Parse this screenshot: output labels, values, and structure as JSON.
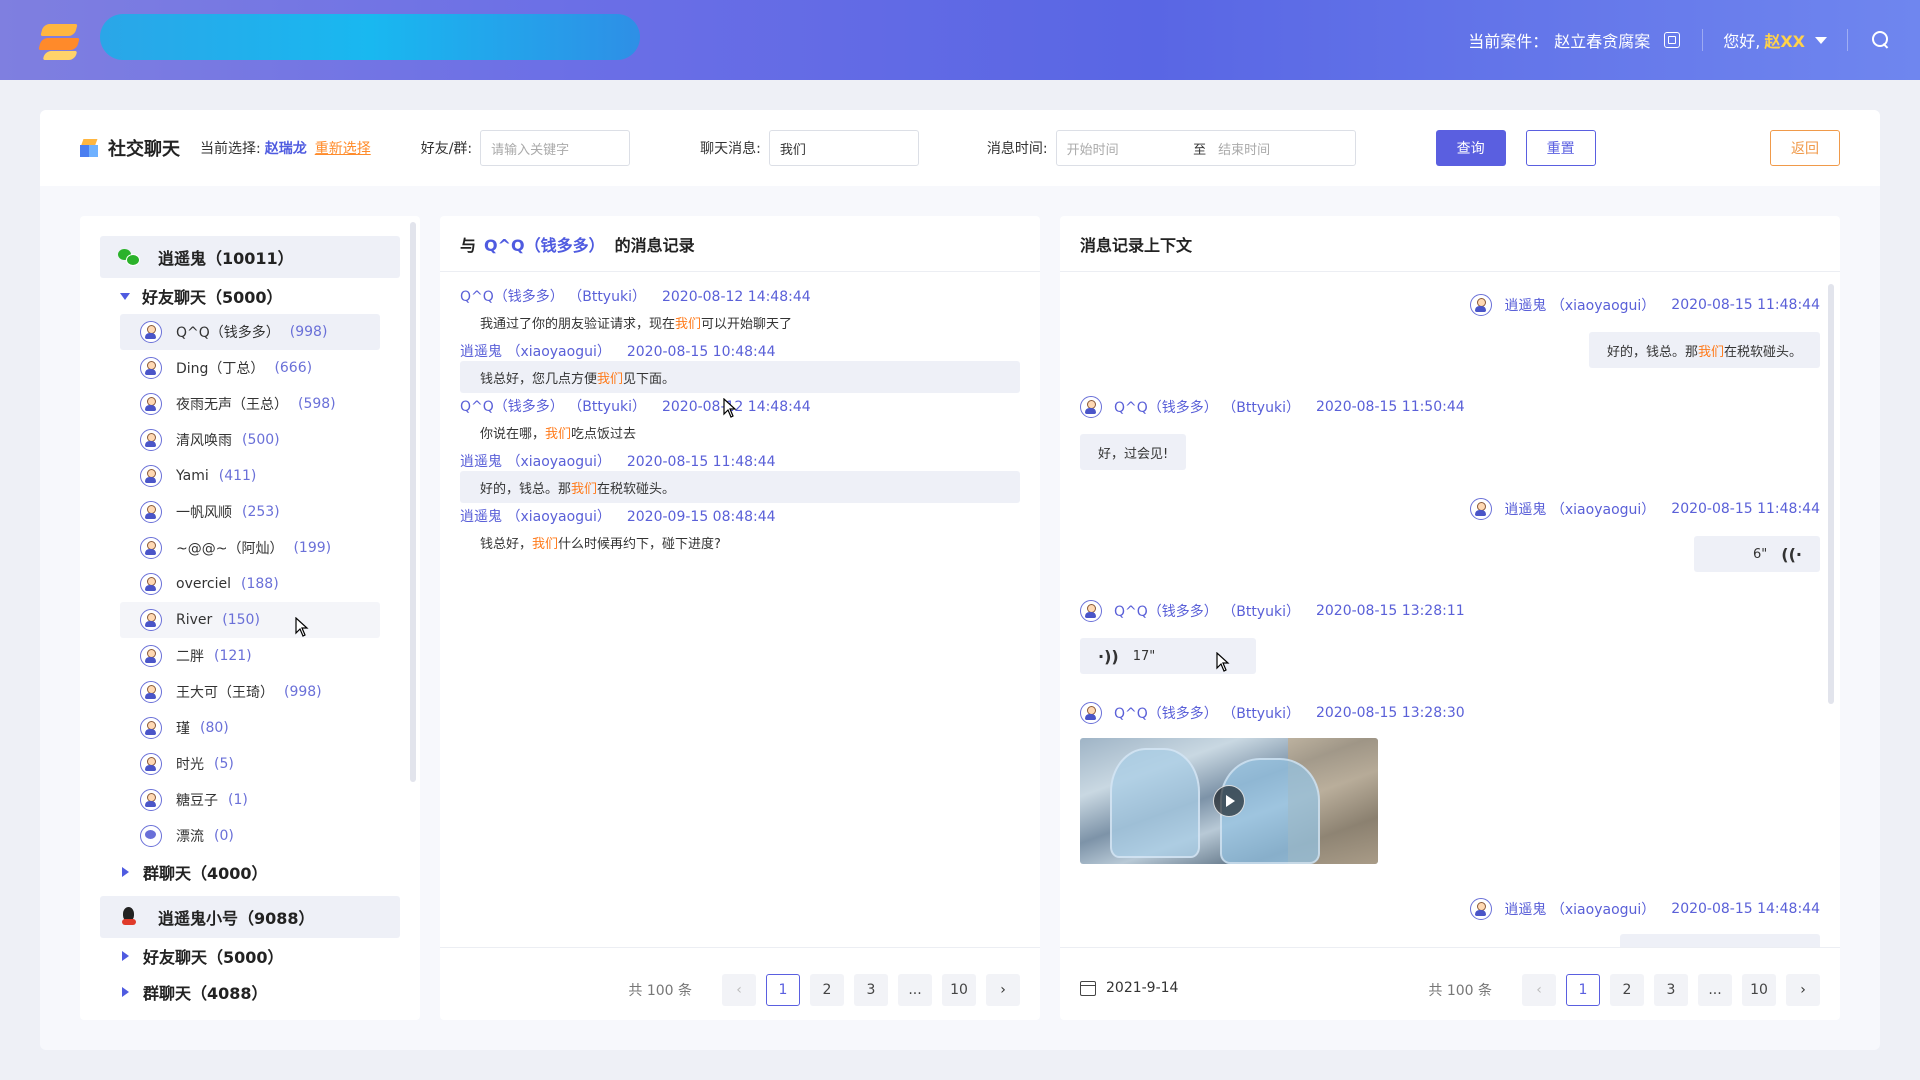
{
  "header": {
    "case_label": "当前案件：",
    "case_value": "赵立春贪腐案",
    "greeting": "您好,",
    "user_name": "赵XX"
  },
  "filter": {
    "title": "社交聊天",
    "current_label": "当前选择:",
    "current_name": "赵瑞龙",
    "reselect": "重新选择",
    "friend_label": "好友/群:",
    "friend_placeholder": "请输入关键字",
    "msg_label": "聊天消息:",
    "msg_value": "我们",
    "time_label": "消息时间:",
    "start_placeholder": "开始时间",
    "range_sep": "至",
    "end_placeholder": "结束时间",
    "query_btn": "查询",
    "reset_btn": "重置",
    "back_btn": "返回"
  },
  "sidebar": {
    "account1": "逍遥鬼（10011）",
    "friends_group": "好友聊天（5000）",
    "friends": [
      {
        "name": "Q^Q（钱多多）",
        "count": "(998)"
      },
      {
        "name": "Ding（丁总）",
        "count": "(666)"
      },
      {
        "name": "夜雨无声（王总）",
        "count": "(598)"
      },
      {
        "name": "清风唤雨",
        "count": "(500)"
      },
      {
        "name": "Yami",
        "count": "(411)"
      },
      {
        "name": "一帆风顺",
        "count": "(253)"
      },
      {
        "name": "~@@~（阿灿）",
        "count": "(199)"
      },
      {
        "name": "overciel",
        "count": "(188)"
      },
      {
        "name": "River",
        "count": "(150)"
      },
      {
        "name": "二胖",
        "count": "(121)"
      },
      {
        "name": "王大可（王琦）",
        "count": "(998)"
      },
      {
        "name": "瑾",
        "count": "(80)"
      },
      {
        "name": "时光",
        "count": "(5)"
      },
      {
        "name": "糖豆子",
        "count": "(1)"
      },
      {
        "name": "漂流",
        "count": "(0)"
      }
    ],
    "group_chat1": "群聊天（4000）",
    "account2": "逍遥鬼小号（9088）",
    "friends_group2": "好友聊天（5000）",
    "group_chat2": "群聊天（4088）"
  },
  "messages": {
    "head_prefix": "与",
    "head_contact": "Q^Q（钱多多）",
    "head_suffix": "的消息记录",
    "items": [
      {
        "sender": "Q^Q（钱多多） （Bttyuki）",
        "time": "2020-08-12 14:48:44",
        "pre": "我通过了你的朋友验证请求，现在",
        "kw": "我们",
        "post": "可以开始聊天了"
      },
      {
        "sender": "逍遥鬼 （xiaoyaogui）",
        "time": "2020-08-15 10:48:44",
        "pre": "钱总好，您几点方便",
        "kw": "我们",
        "post": "见下面。"
      },
      {
        "sender": "Q^Q（钱多多） （Bttyuki）",
        "time": "2020-08-12 14:48:44",
        "pre": "你说在哪，",
        "kw": "我们",
        "post": "吃点饭过去"
      },
      {
        "sender": "逍遥鬼 （xiaoyaogui）",
        "time": "2020-08-15 11:48:44",
        "pre": "好的，钱总。那",
        "kw": "我们",
        "post": "在税软碰头。"
      },
      {
        "sender": "逍遥鬼 （xiaoyaogui）",
        "time": "2020-09-15 08:48:44",
        "pre": "钱总好，",
        "kw": "我们",
        "post": "什么时候再约下，碰下进度?"
      }
    ],
    "pager": {
      "total": "共 100 条",
      "pages": [
        "1",
        "2",
        "3",
        "...",
        "10"
      ]
    }
  },
  "context": {
    "title": "消息记录上下文",
    "items": [
      {
        "sender": "逍遥鬼 （xiaoyaogui）",
        "time": "2020-08-15 11:48:44",
        "pre": "好的，钱总。那",
        "kw": "我们",
        "post": "在税软碰头。"
      },
      {
        "sender": "Q^Q（钱多多） （Bttyuki）",
        "time": "2020-08-15 11:50:44",
        "text": "好，过会见!"
      },
      {
        "sender": "逍遥鬼 （xiaoyaogui）",
        "time": "2020-08-15 11:48:44",
        "voice": "6\""
      },
      {
        "sender": "Q^Q（钱多多） （Bttyuki）",
        "time": "2020-08-15 13:28:11",
        "voice": "17\""
      },
      {
        "sender": "Q^Q（钱多多） （Bttyuki）",
        "time": "2020-08-15 13:28:30"
      },
      {
        "sender": "逍遥鬼 （xiaoyaogui）",
        "time": "2020-08-15 14:48:44"
      }
    ],
    "date": "2021-9-14",
    "pager": {
      "total": "共 100 条",
      "pages": [
        "1",
        "2",
        "3",
        "...",
        "10"
      ]
    }
  }
}
